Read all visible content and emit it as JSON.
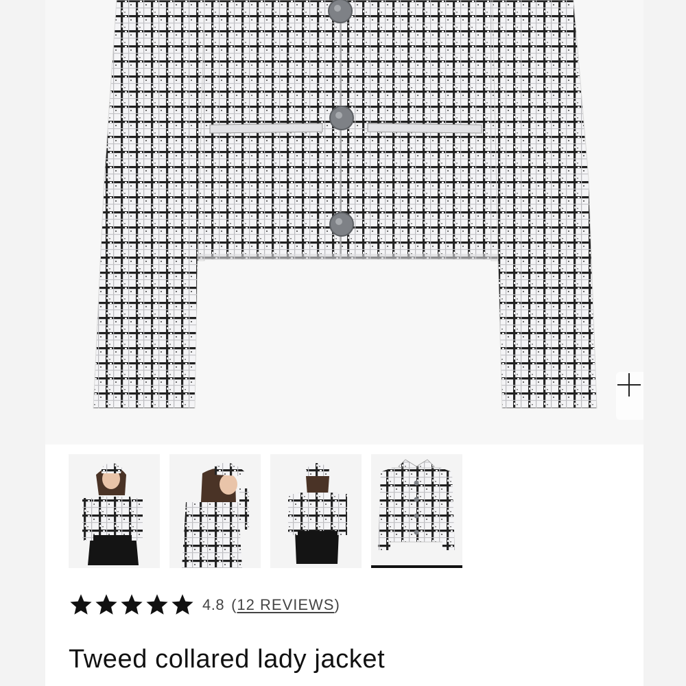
{
  "gallery": {
    "zoom_icon": "plus-icon",
    "active_thumbnail": 3,
    "thumbnails": [
      {
        "name": "thumb-front-model"
      },
      {
        "name": "thumb-side-model"
      },
      {
        "name": "thumb-back-model"
      },
      {
        "name": "thumb-flat-lay"
      }
    ]
  },
  "product": {
    "rating": {
      "stars": 5,
      "value": "4.8",
      "open_paren": "(",
      "reviews_label": "12 REVIEWS",
      "close_paren": ")"
    },
    "title": "Tweed collared lady jacket"
  },
  "colors": {
    "star": "#111111",
    "text": "#111111",
    "muted": "#444444",
    "tweed_dark": "#1b1b1b",
    "button_gray": "#7c7f84"
  }
}
